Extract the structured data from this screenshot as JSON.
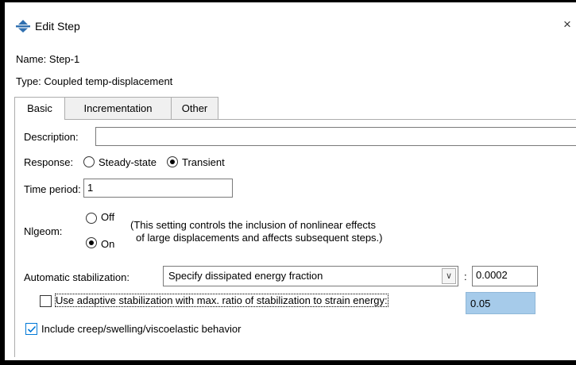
{
  "window": {
    "title": "Edit Step",
    "close_glyph": "×"
  },
  "step": {
    "name_label": "Name:",
    "name_value": "Step-1",
    "type_label": "Type:",
    "type_value": "Coupled temp-displacement"
  },
  "tabs": [
    {
      "label": "Basic",
      "active": true
    },
    {
      "label": "Incrementation",
      "active": false
    },
    {
      "label": "Other",
      "active": false
    }
  ],
  "basic": {
    "description_label": "Description:",
    "description_value": "",
    "response_label": "Response:",
    "response_options": [
      {
        "label": "Steady-state",
        "selected": false
      },
      {
        "label": "Transient",
        "selected": true
      }
    ],
    "time_period_label": "Time period:",
    "time_period_value": "1",
    "nlgeom_label": "Nlgeom:",
    "nlgeom_options": [
      {
        "label": "Off",
        "selected": false
      },
      {
        "label": "On",
        "selected": true
      }
    ],
    "nlgeom_note_line1": "(This setting controls the inclusion of nonlinear effects",
    "nlgeom_note_line2": "of large displacements and affects subsequent steps.)",
    "stabilization_label": "Automatic stabilization:",
    "stabilization_selected": "Specify dissipated energy fraction",
    "stabilization_colon": ":",
    "stabilization_value": "0.0002",
    "adaptive_label": "Use adaptive stabilization with max. ratio of stabilization to strain energy:",
    "adaptive_checked": false,
    "adaptive_value": "0.05",
    "creep_label": "Include creep/swelling/viscoelastic behavior",
    "creep_checked": true
  },
  "colors": {
    "checkbox_accent": "#0078d7",
    "disabled_field": "#a6cbea",
    "icon_main": "#2f6fb0"
  }
}
